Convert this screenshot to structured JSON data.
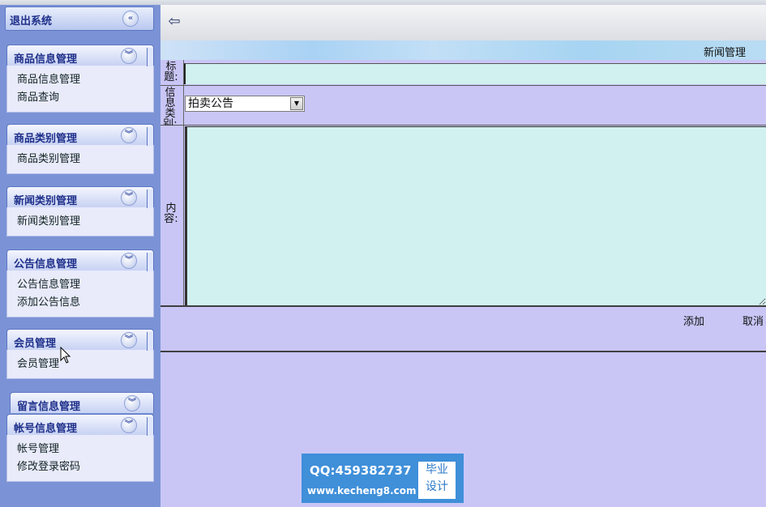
{
  "sidebar": {
    "logout_label": "退出系统",
    "groups": [
      {
        "title": "商品信息管理",
        "items": [
          "商品信息管理",
          "商品查询"
        ]
      },
      {
        "title": "商品类别管理",
        "items": [
          "商品类别管理"
        ]
      },
      {
        "title": "新闻类别管理",
        "items": [
          "新闻类别管理"
        ]
      },
      {
        "title": "公告信息管理",
        "items": [
          "公告信息管理",
          "添加公告信息"
        ]
      },
      {
        "title": "会员管理",
        "items": [
          "会员管理"
        ]
      },
      {
        "title": "留言信息管理",
        "items": []
      },
      {
        "title": "帐号信息管理",
        "items": [
          "帐号管理",
          "修改登录密码"
        ]
      }
    ]
  },
  "banner": {
    "title": "新闻管理"
  },
  "form": {
    "title_label": "标题:",
    "type_label": "信息类别:",
    "type_selected": "拍卖公告",
    "content_label": "内容:",
    "title_value": "",
    "content_value": ""
  },
  "actions": {
    "add": "添加",
    "cancel": "取消"
  },
  "watermark": {
    "qq": "QQ:459382737",
    "url": "www.kecheng8.com",
    "badge_line1": "毕业",
    "badge_line2": "设计"
  },
  "colors": {
    "sidebar_bg": "#7b93d6",
    "main_bg": "#c9c6f6",
    "input_bg": "#d0f1ef",
    "watermark_bg": "#3f8fd9"
  }
}
